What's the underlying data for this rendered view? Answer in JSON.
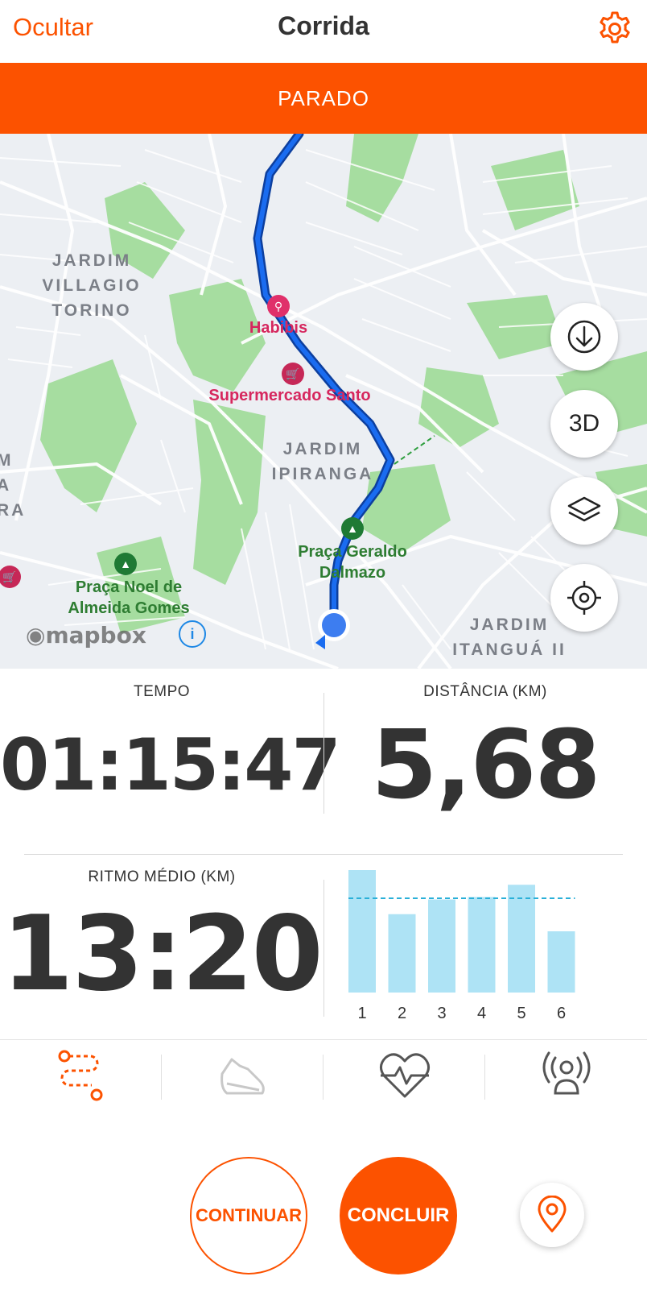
{
  "header": {
    "hide_label": "Ocultar",
    "title": "Corrida",
    "settings_icon": "gear-icon"
  },
  "status": {
    "label": "PARADO",
    "color": "#fc5200"
  },
  "map": {
    "neighborhoods": [
      {
        "text": "JARDIM\nVILLAGIO\nTORINO"
      },
      {
        "text": "JARDIM\nIPIRANGA"
      },
      {
        "text": "M\nA\nRA"
      },
      {
        "text": "JARDIM\nITANGUÁ II"
      }
    ],
    "pois": [
      {
        "text": "Habibis",
        "icon": "restaurant-icon"
      },
      {
        "text": "Supermercado Santo",
        "icon": "shopping-cart-icon"
      },
      {
        "text": "Praça Geraldo\nDalmazo",
        "icon": "tree-icon"
      },
      {
        "text": "Praça Noel de\nAlmeida Gomes",
        "icon": "tree-icon"
      }
    ],
    "attribution": "mapbox",
    "controls": {
      "download_icon": "download-icon",
      "view_3d_label": "3D",
      "layers_icon": "layers-icon",
      "locate_icon": "crosshair-icon"
    },
    "route_color": "#1a5fd6"
  },
  "stats": {
    "time_label": "TEMPO",
    "time_value": "01:15:47",
    "distance_label": "DISTÂNCIA (KM)",
    "distance_value": "5,68",
    "pace_label": "RITMO MÉDIO (KM)",
    "pace_value": "13:20"
  },
  "chart_data": {
    "type": "bar",
    "categories": [
      "1",
      "2",
      "3",
      "4",
      "5",
      "6"
    ],
    "values": [
      1.0,
      0.64,
      0.76,
      0.78,
      0.88,
      0.5
    ],
    "average_line": 0.77,
    "bar_color": "#aee3f5",
    "average_line_color": "#2ab0d8"
  },
  "tabs": [
    {
      "icon": "route-icon",
      "active": true
    },
    {
      "icon": "shoe-icon",
      "active": false
    },
    {
      "icon": "heart-rate-icon",
      "active": false
    },
    {
      "icon": "beacon-icon",
      "active": false
    }
  ],
  "actions": {
    "continue_label": "CONTINUAR",
    "finish_label": "CONCLUIR",
    "pin_icon": "location-pin-icon",
    "accent": "#fc5200"
  }
}
